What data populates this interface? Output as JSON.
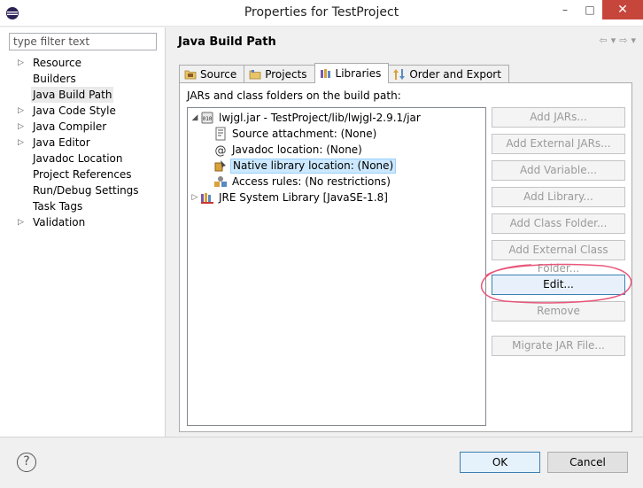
{
  "window": {
    "title": "Properties for TestProject",
    "minimize": "–",
    "maximize": "□",
    "close": "✕"
  },
  "filter": {
    "placeholder": "type filter text"
  },
  "nav": {
    "items": [
      {
        "label": "Resource",
        "expandable": true
      },
      {
        "label": "Builders",
        "expandable": false
      },
      {
        "label": "Java Build Path",
        "expandable": false,
        "selected": true
      },
      {
        "label": "Java Code Style",
        "expandable": true
      },
      {
        "label": "Java Compiler",
        "expandable": true
      },
      {
        "label": "Java Editor",
        "expandable": true
      },
      {
        "label": "Javadoc Location",
        "expandable": false
      },
      {
        "label": "Project References",
        "expandable": false
      },
      {
        "label": "Run/Debug Settings",
        "expandable": false
      },
      {
        "label": "Task Tags",
        "expandable": false
      },
      {
        "label": "Validation",
        "expandable": true
      }
    ]
  },
  "page": {
    "title": "Java Build Path"
  },
  "tabs": [
    {
      "label": "Source",
      "icon": "source-folder-icon"
    },
    {
      "label": "Projects",
      "icon": "projects-icon"
    },
    {
      "label": "Libraries",
      "icon": "libraries-icon",
      "active": true
    },
    {
      "label": "Order and Export",
      "icon": "order-export-icon"
    }
  ],
  "libraries": {
    "caption": "JARs and class folders on the build path:",
    "tree": [
      {
        "label": "lwjgl.jar - TestProject/lib/lwjgl-2.9.1/jar",
        "level": 0,
        "expander": "▲",
        "icon": "jar-icon"
      },
      {
        "label": "Source attachment: (None)",
        "level": 1,
        "icon": "source-attachment-icon"
      },
      {
        "label": "Javadoc location: (None)",
        "level": 1,
        "icon": "javadoc-icon"
      },
      {
        "label": "Native library location: (None)",
        "level": 1,
        "icon": "native-library-icon",
        "selected": true
      },
      {
        "label": "Access rules: (No restrictions)",
        "level": 1,
        "icon": "access-rules-icon"
      },
      {
        "label": "JRE System Library [JavaSE-1.8]",
        "level": 0,
        "expander": "▷",
        "icon": "jre-library-icon"
      }
    ],
    "buttons": {
      "add_jars": "Add JARs...",
      "add_external_jars": "Add External JARs...",
      "add_variable": "Add Variable...",
      "add_library": "Add Library...",
      "add_class_folder": "Add Class Folder...",
      "add_external_class_folder": "Add External Class Folder...",
      "edit": "Edit...",
      "remove": "Remove",
      "migrate_jar": "Migrate JAR File..."
    }
  },
  "footer": {
    "help": "?",
    "ok": "OK",
    "cancel": "Cancel"
  },
  "colors": {
    "selection": "#cce8ff",
    "annotation": "#e8577a",
    "close_button": "#c7463c"
  }
}
